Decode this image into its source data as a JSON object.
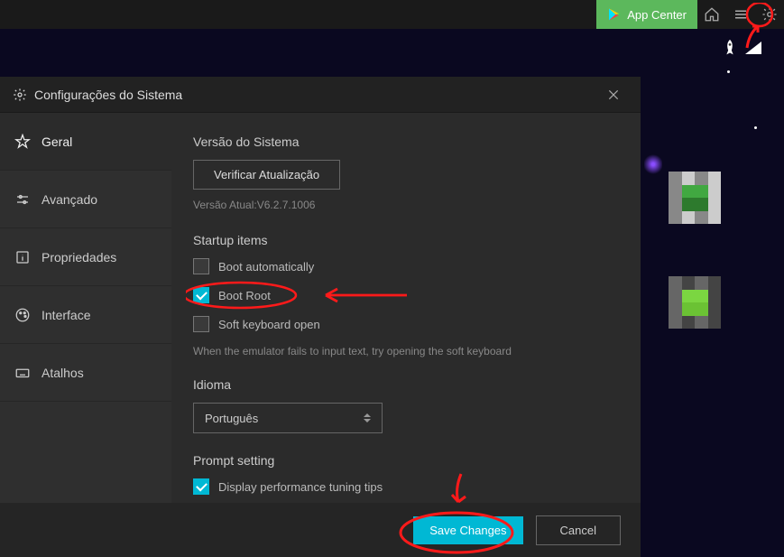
{
  "topbar": {
    "app_center": "App Center"
  },
  "settings": {
    "title": "Configurações do Sistema",
    "sidebar": [
      {
        "label": "Geral"
      },
      {
        "label": "Avançado"
      },
      {
        "label": "Propriedades"
      },
      {
        "label": "Interface"
      },
      {
        "label": "Atalhos"
      }
    ],
    "system_version_section": "Versão do Sistema",
    "check_update_btn": "Verificar Atualização",
    "current_version": "Versão Atual:V6.2.7.1006",
    "startup_section": "Startup items",
    "boot_auto_label": "Boot automatically",
    "boot_root_label": "Boot Root",
    "soft_keyboard_label": "Soft keyboard open",
    "soft_keyboard_hint": "When the emulator fails to input text, try opening the soft keyboard",
    "language_section": "Idioma",
    "language_value": "Português",
    "prompt_section": "Prompt setting",
    "perf_tips_label": "Display performance tuning tips",
    "save_btn": "Save Changes",
    "cancel_btn": "Cancel"
  },
  "checkboxes": {
    "boot_auto": false,
    "boot_root": true,
    "soft_keyboard": false,
    "perf_tips": true
  }
}
